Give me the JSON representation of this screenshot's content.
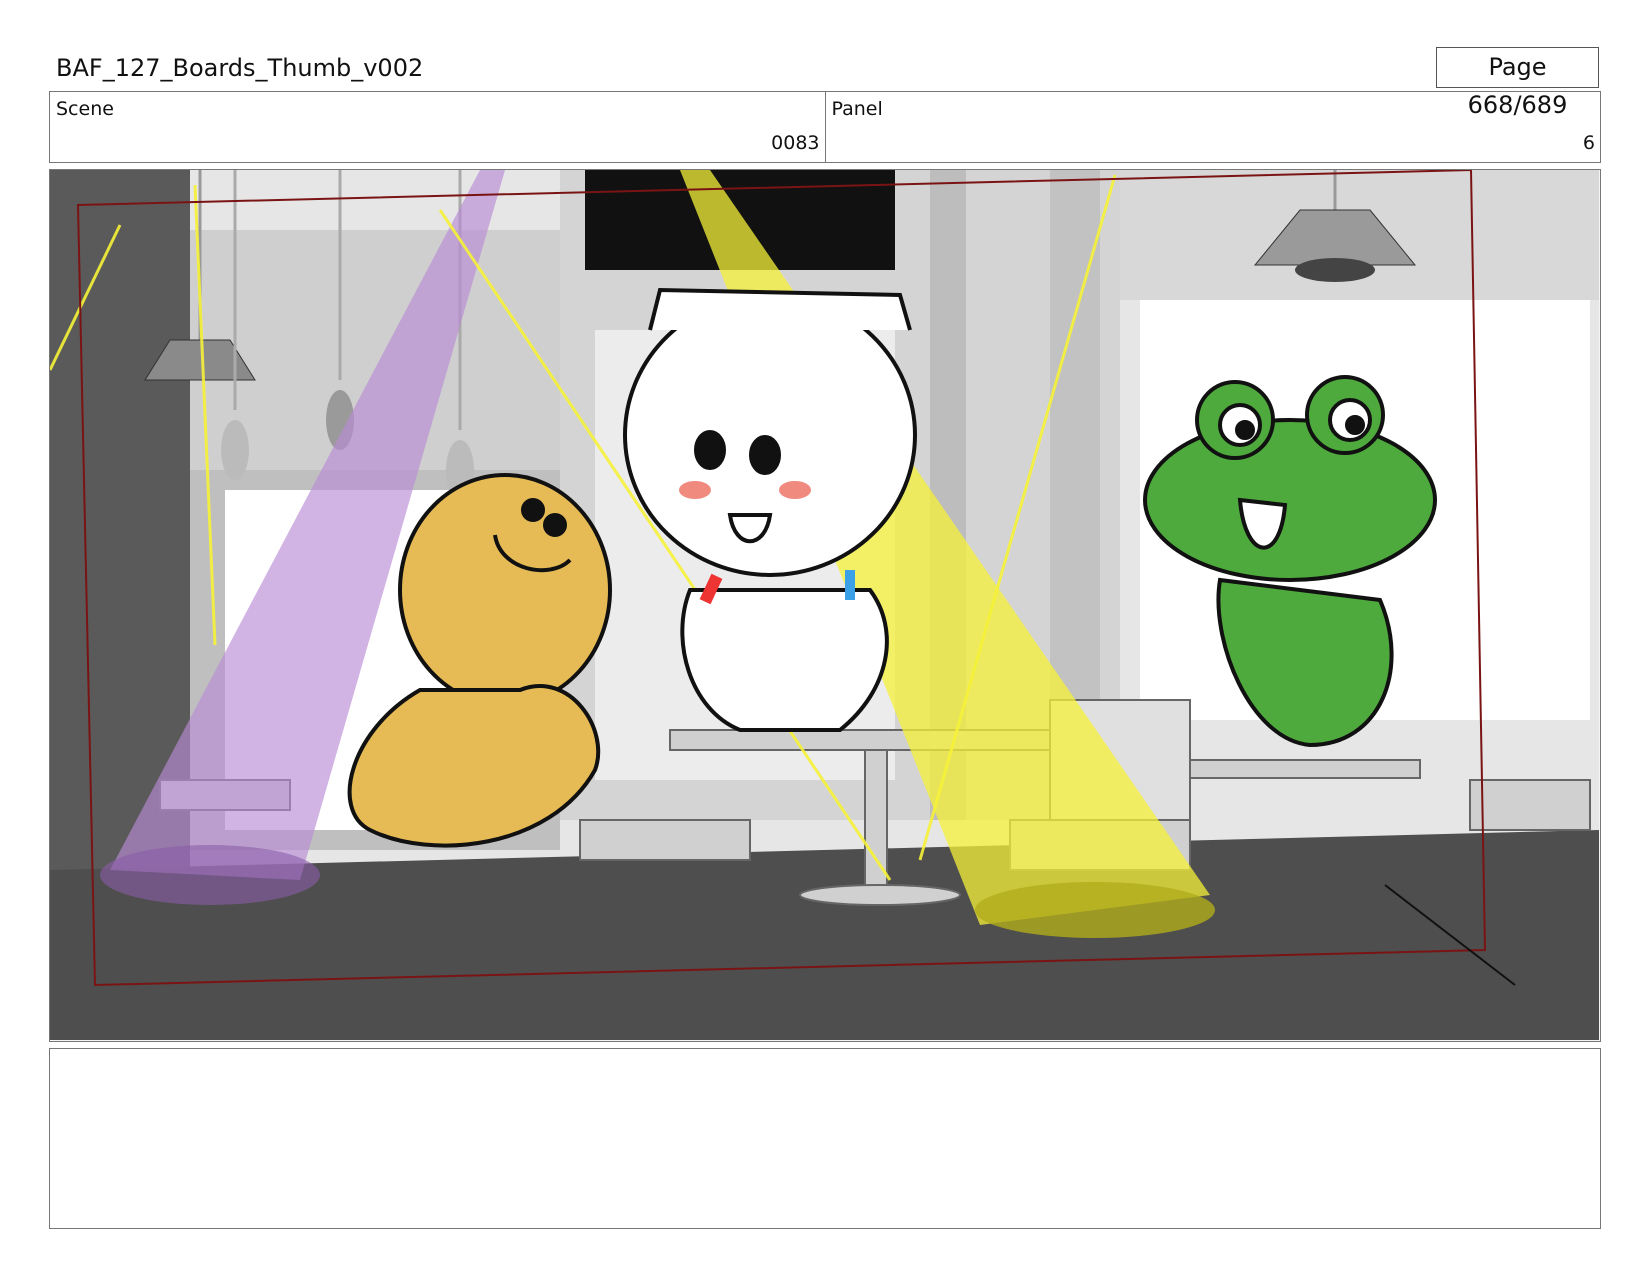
{
  "header": {
    "doc_title": "BAF_127_Boards_Thumb_v002",
    "page_label": "Page 668/689"
  },
  "info": {
    "scene_label": "Scene",
    "scene_value": "0083",
    "panel_label": "Panel",
    "panel_value": "6"
  },
  "panel_image": {
    "description_name": "storyboard-frame",
    "spotlight_colors": {
      "purple": "#b98ad6",
      "yellow": "#f6f238"
    },
    "character_colors": {
      "bear": "#e6bb55",
      "frog": "#4faa3e",
      "bunny": "#ffffff",
      "safe_frame": "#7a1414"
    }
  },
  "notes": {
    "text": ""
  }
}
